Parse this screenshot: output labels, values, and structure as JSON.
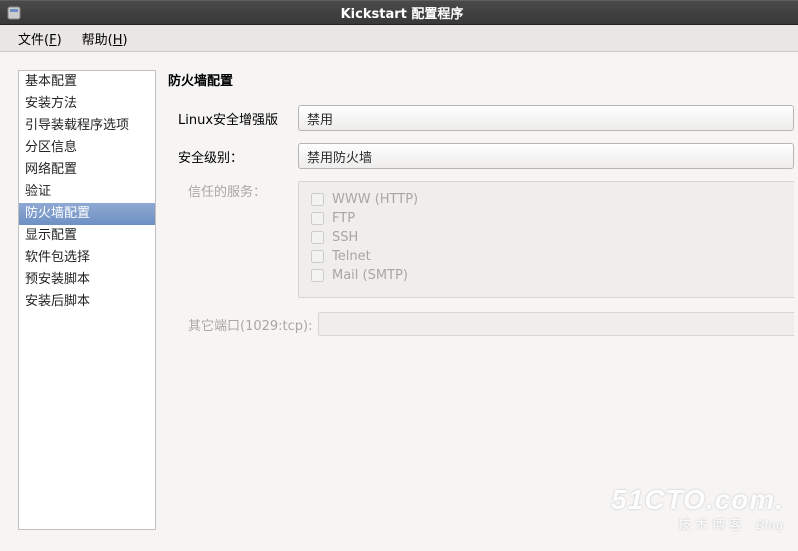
{
  "window": {
    "title": "Kickstart 配置程序"
  },
  "menubar": {
    "file": {
      "label": "文件",
      "mnemonic": "F"
    },
    "help": {
      "label": "帮助",
      "mnemonic": "H"
    }
  },
  "sidebar": {
    "items": [
      {
        "label": "基本配置"
      },
      {
        "label": "安装方法"
      },
      {
        "label": "引导装载程序选项"
      },
      {
        "label": "分区信息"
      },
      {
        "label": "网络配置"
      },
      {
        "label": "验证"
      },
      {
        "label": "防火墙配置",
        "selected": true
      },
      {
        "label": "显示配置"
      },
      {
        "label": "软件包选择"
      },
      {
        "label": "预安装脚本"
      },
      {
        "label": "安装后脚本"
      }
    ]
  },
  "main": {
    "heading": "防火墙配置",
    "selinux_label": "Linux安全增强版",
    "selinux_value": "禁用",
    "seclevel_label": "安全级别：",
    "seclevel_value": "禁用防火墙",
    "trusted_label": "信任的服务：",
    "services": [
      {
        "label": "WWW (HTTP)"
      },
      {
        "label": "FTP"
      },
      {
        "label": "SSH"
      },
      {
        "label": "Telnet"
      },
      {
        "label": "Mail (SMTP)"
      }
    ],
    "other_ports_label": "其它端口(1029:tcp):"
  },
  "watermark": {
    "line1": "51CTO.com.",
    "line2a": "技术博客",
    "line2b": "Blog"
  }
}
